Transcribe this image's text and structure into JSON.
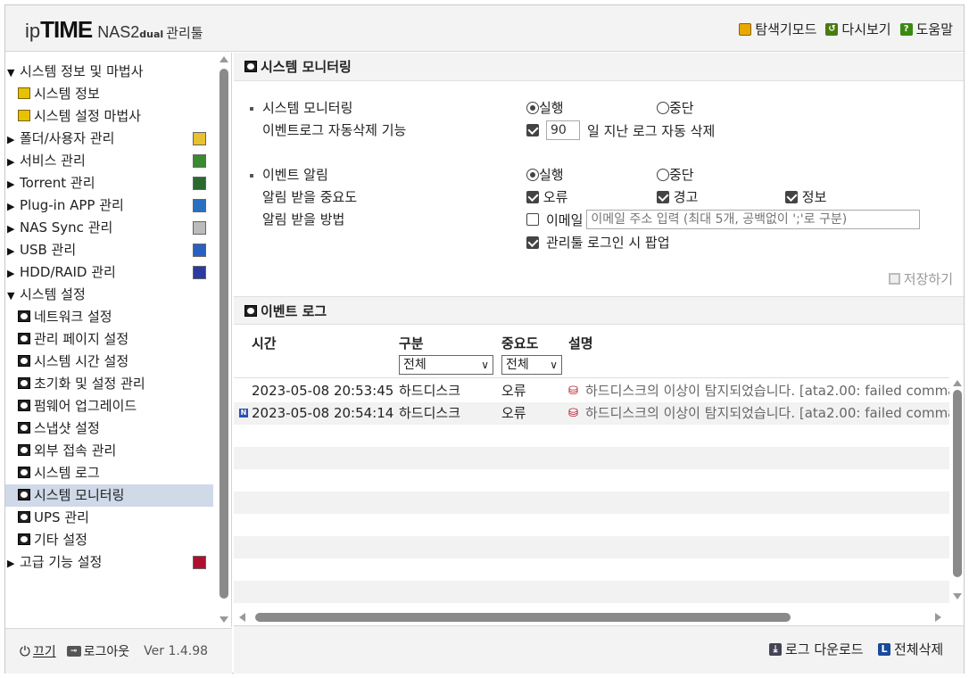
{
  "header": {
    "logo_ip": "ip",
    "logo_time": "TIME",
    "logo_model": "NAS2",
    "logo_dual": "dual",
    "logo_admin": "관리툴",
    "nav": {
      "explorer": "탐색기모드",
      "reload": "다시보기",
      "help": "도움말"
    }
  },
  "sidebar": {
    "items": [
      {
        "label": "시스템 정보 및 마법사"
      },
      {
        "label": "시스템 정보"
      },
      {
        "label": "시스템 설정 마법사"
      },
      {
        "label": "폴더/사용자 관리"
      },
      {
        "label": "서비스 관리"
      },
      {
        "label": "Torrent 관리"
      },
      {
        "label": "Plug-in APP 관리"
      },
      {
        "label": "NAS Sync 관리"
      },
      {
        "label": "USB 관리"
      },
      {
        "label": "HDD/RAID 관리"
      },
      {
        "label": "시스템 설정"
      },
      {
        "label": "네트워크 설정"
      },
      {
        "label": "관리 페이지 설정"
      },
      {
        "label": "시스템 시간 설정"
      },
      {
        "label": "초기화 및 설정 관리"
      },
      {
        "label": "펌웨어 업그레이드"
      },
      {
        "label": "스냅샷 설정"
      },
      {
        "label": "외부 접속 관리"
      },
      {
        "label": "시스템 로그"
      },
      {
        "label": "시스템 모니터링"
      },
      {
        "label": "UPS 관리"
      },
      {
        "label": "기타 설정"
      },
      {
        "label": "고급 기능 설정"
      }
    ],
    "footer": {
      "power": "끄기",
      "logout": "로그아웃",
      "version": "Ver 1.4.98"
    }
  },
  "monitor": {
    "title": "시스템 모니터링",
    "monitoring_label": "시스템 모니터링",
    "run_label": "실행",
    "stop_label": "중단",
    "autodelete_label": "이벤트로그 자동삭제 기능",
    "autodelete_days": "90",
    "autodelete_suffix": "일 지난 로그 자동 삭제",
    "alert_label": "이벤트 알림",
    "alert_run": "실행",
    "alert_stop": "중단",
    "severity_label": "알림 받을 중요도",
    "sev_error": "오류",
    "sev_warn": "경고",
    "sev_info": "정보",
    "method_label": "알림 받을 방법",
    "email_label": "이메일",
    "email_placeholder": "이메일 주소 입력 (최대 5개, 공백없이 ';'로 구분)",
    "popup_label": "관리툴 로그인 시 팝업",
    "save_label": "저장하기"
  },
  "eventlog": {
    "title": "이벤트 로그",
    "columns": {
      "time": "시간",
      "category": "구분",
      "severity": "중요도",
      "desc": "설명"
    },
    "filter_category": "전체",
    "filter_severity": "전체",
    "rows": [
      {
        "time": "2023-05-08 20:53:45",
        "category": "하드디스크",
        "severity": "오류",
        "desc": "하드디스크의 이상이 탐지되었습니다. [ata2.00: failed comma",
        "new": false
      },
      {
        "time": "2023-05-08 20:54:14",
        "category": "하드디스크",
        "severity": "오류",
        "desc": "하드디스크의 이상이 탐지되었습니다. [ata2.00: failed comma",
        "new": true
      }
    ],
    "new_badge": "N",
    "download_label": "로그 다운로드",
    "delete_all_label": "전체삭제"
  }
}
